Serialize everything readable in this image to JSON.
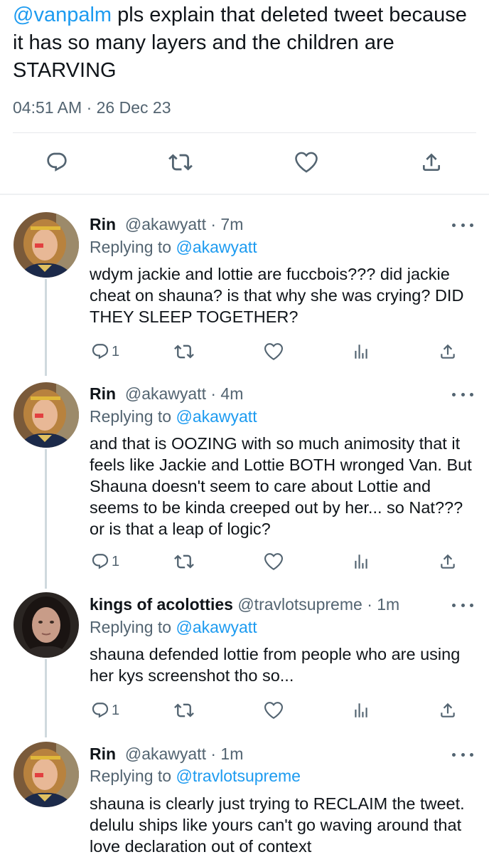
{
  "main_tweet": {
    "mention": "@vanpalm",
    "text": " pls explain that deleted tweet because it has so many layers and the children are STARVING",
    "time": "04:51 AM",
    "separator": "·",
    "date": "26 Dec 23"
  },
  "replies": [
    {
      "name": "Rin",
      "handle": "@akawyatt",
      "dot": "·",
      "time": "7m",
      "replying_prefix": "Replying to ",
      "replying_to": "@akawyatt",
      "text": "wdym jackie and lottie are fuccbois??? did jackie cheat on shauna? is that why she was crying? DID THEY SLEEP TOGETHER?",
      "reply_count": "1"
    },
    {
      "name": "Rin",
      "handle": "@akawyatt",
      "dot": "·",
      "time": "4m",
      "replying_prefix": "Replying to ",
      "replying_to": "@akawyatt",
      "text": "and that is OOZING with so much animosity that it feels like Jackie and Lottie BOTH wronged Van. But Shauna doesn't seem to care about Lottie and seems to be kinda creeped out by her... so Nat???  or is that a leap of logic?",
      "reply_count": "1"
    },
    {
      "name": "kings of acolotties",
      "handle": "@travlotsupreme",
      "dot": "·",
      "time": "1m",
      "replying_prefix": "Replying to ",
      "replying_to": "@akawyatt",
      "text": "shauna defended lottie from people who are using her kys screenshot tho so...",
      "reply_count": "1"
    },
    {
      "name": "Rin",
      "handle": "@akawyatt",
      "dot": "·",
      "time": "1m",
      "replying_prefix": "Replying to ",
      "replying_to": "@travlotsupreme",
      "text": "shauna is clearly just trying to RECLAIM the tweet. delulu ships like yours can't go waving around that love declaration out of context",
      "reply_count": ""
    }
  ],
  "colors": {
    "accent": "#1d9bf0",
    "secondary_text": "#536471",
    "thread_line": "#cfd9de"
  },
  "icons": [
    "reply-icon",
    "retweet-icon",
    "like-icon",
    "share-icon",
    "views-icon",
    "more-icon"
  ]
}
